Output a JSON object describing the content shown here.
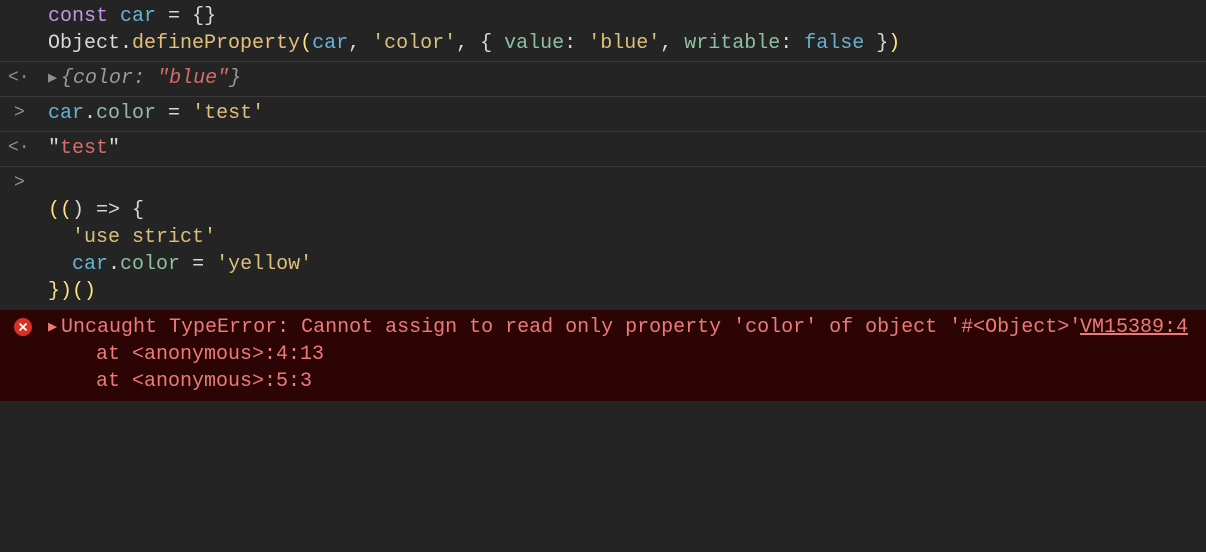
{
  "entries": [
    {
      "type": "input",
      "gutter": "",
      "code": {
        "kind": "define",
        "line1": {
          "const": "const",
          "sp": " ",
          "var": "car",
          "eq": " = ",
          "braces": "{}"
        },
        "line2": {
          "obj": "Object",
          "dot": ".",
          "fn": "defineProperty",
          "open": "(",
          "var": "car",
          "c1": ", ",
          "s1": "'color'",
          "c2": ", ",
          "b1": "{ ",
          "p1": "value",
          "col1": ": ",
          "s2": "'blue'",
          "c3": ", ",
          "p2": "writable",
          "col2": ": ",
          "bool": "false",
          "b2": " }",
          "close": ")"
        }
      }
    },
    {
      "type": "result",
      "gutter": "<·",
      "triangle": "▶",
      "preview": {
        "open": "{",
        "key": "color",
        "col": ": ",
        "val": "\"blue\"",
        "close": "}"
      }
    },
    {
      "type": "input",
      "gutter": ">",
      "code": {
        "kind": "assign",
        "var": "car",
        "dot": ".",
        "prop": "color",
        "eq": " = ",
        "str": "'test'"
      }
    },
    {
      "type": "result",
      "gutter": "<·",
      "literal": {
        "q1": "\"",
        "val": "test",
        "q2": "\""
      }
    },
    {
      "type": "input",
      "gutter": ">",
      "code": {
        "kind": "iife",
        "l1": {
          "open": "((",
          "arrow": ") => {",
          "close": ""
        },
        "l2": {
          "indent": "  ",
          "str": "'use strict'"
        },
        "l3": {
          "indent": "  ",
          "var": "car",
          "dot": ".",
          "prop": "color",
          "eq": " = ",
          "str": "'yellow'"
        },
        "l4": {
          "close": "})()"
        }
      }
    }
  ],
  "error": {
    "triangle": "▶",
    "message": "Uncaught TypeError: Cannot assign to read only property 'color' of object '#<Object>'",
    "stack": "    at <anonymous>:4:13\n    at <anonymous>:5:3",
    "source": "VM15389:4"
  }
}
